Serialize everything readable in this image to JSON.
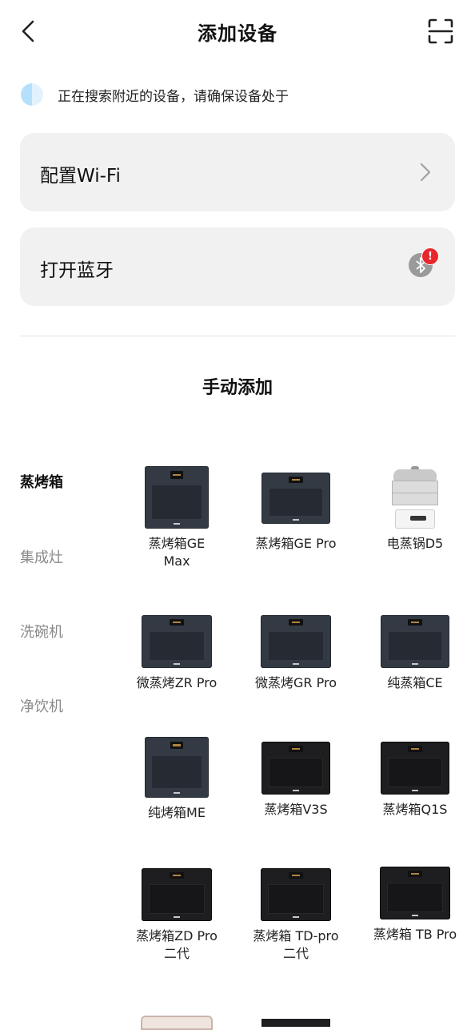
{
  "header": {
    "title": "添加设备"
  },
  "search": {
    "text": "正在搜索附近的设备，请确保设备处于"
  },
  "wifi_card": {
    "label": "配置Wi-Fi"
  },
  "bt_card": {
    "label": "打开蓝牙",
    "badge": "!"
  },
  "manual": {
    "title": "手动添加"
  },
  "categories": [
    {
      "label": "蒸烤箱",
      "active": true
    },
    {
      "label": "集成灶",
      "active": false
    },
    {
      "label": "洗碗机",
      "active": false
    },
    {
      "label": "净饮机",
      "active": false
    }
  ],
  "products": [
    {
      "name": "蒸烤箱GE Max",
      "line1": "蒸烤箱GE",
      "line2": "Max",
      "style": "gray-tall"
    },
    {
      "name": "蒸烤箱GE Pro",
      "line1": "蒸烤箱GE Pro",
      "line2": "",
      "style": "gray-wide"
    },
    {
      "name": "电蒸锅D5",
      "line1": "电蒸锅D5",
      "line2": "",
      "style": "steamer"
    },
    {
      "name": "微蒸烤ZR Pro",
      "line1": "微蒸烤ZR Pro",
      "line2": "",
      "style": "gray-wide"
    },
    {
      "name": "微蒸烤GR Pro",
      "line1": "微蒸烤GR Pro",
      "line2": "",
      "style": "gray-wide"
    },
    {
      "name": "纯蒸箱CE",
      "line1": "纯蒸箱CE",
      "line2": "",
      "style": "gray-wide"
    },
    {
      "name": "纯烤箱ME",
      "line1": "纯烤箱ME",
      "line2": "",
      "style": "gray-tall"
    },
    {
      "name": "蒸烤箱V3S",
      "line1": "蒸烤箱V3S",
      "line2": "",
      "style": "black"
    },
    {
      "name": "蒸烤箱Q1S",
      "line1": "蒸烤箱Q1S",
      "line2": "",
      "style": "black"
    },
    {
      "name": "蒸烤箱ZD Pro 二代",
      "line1": "蒸烤箱ZD Pro",
      "line2": "二代",
      "style": "black"
    },
    {
      "name": "蒸烤箱 TD-pro 二代",
      "line1": "蒸烤箱 TD-pro",
      "line2": "二代",
      "style": "black"
    },
    {
      "name": "蒸烤箱 TB Pro",
      "line1": "蒸烤箱 TB Pro",
      "line2": "",
      "style": "black"
    }
  ],
  "colors": {
    "card_bg": "#f1f1f1",
    "badge": "#e8262c",
    "inactive_category": "#8a8a8a"
  },
  "icons": {
    "back": "chevron-left-icon",
    "scan": "scan-icon",
    "wifi_arrow": "chevron-right-icon",
    "bluetooth": "bluetooth-icon"
  }
}
